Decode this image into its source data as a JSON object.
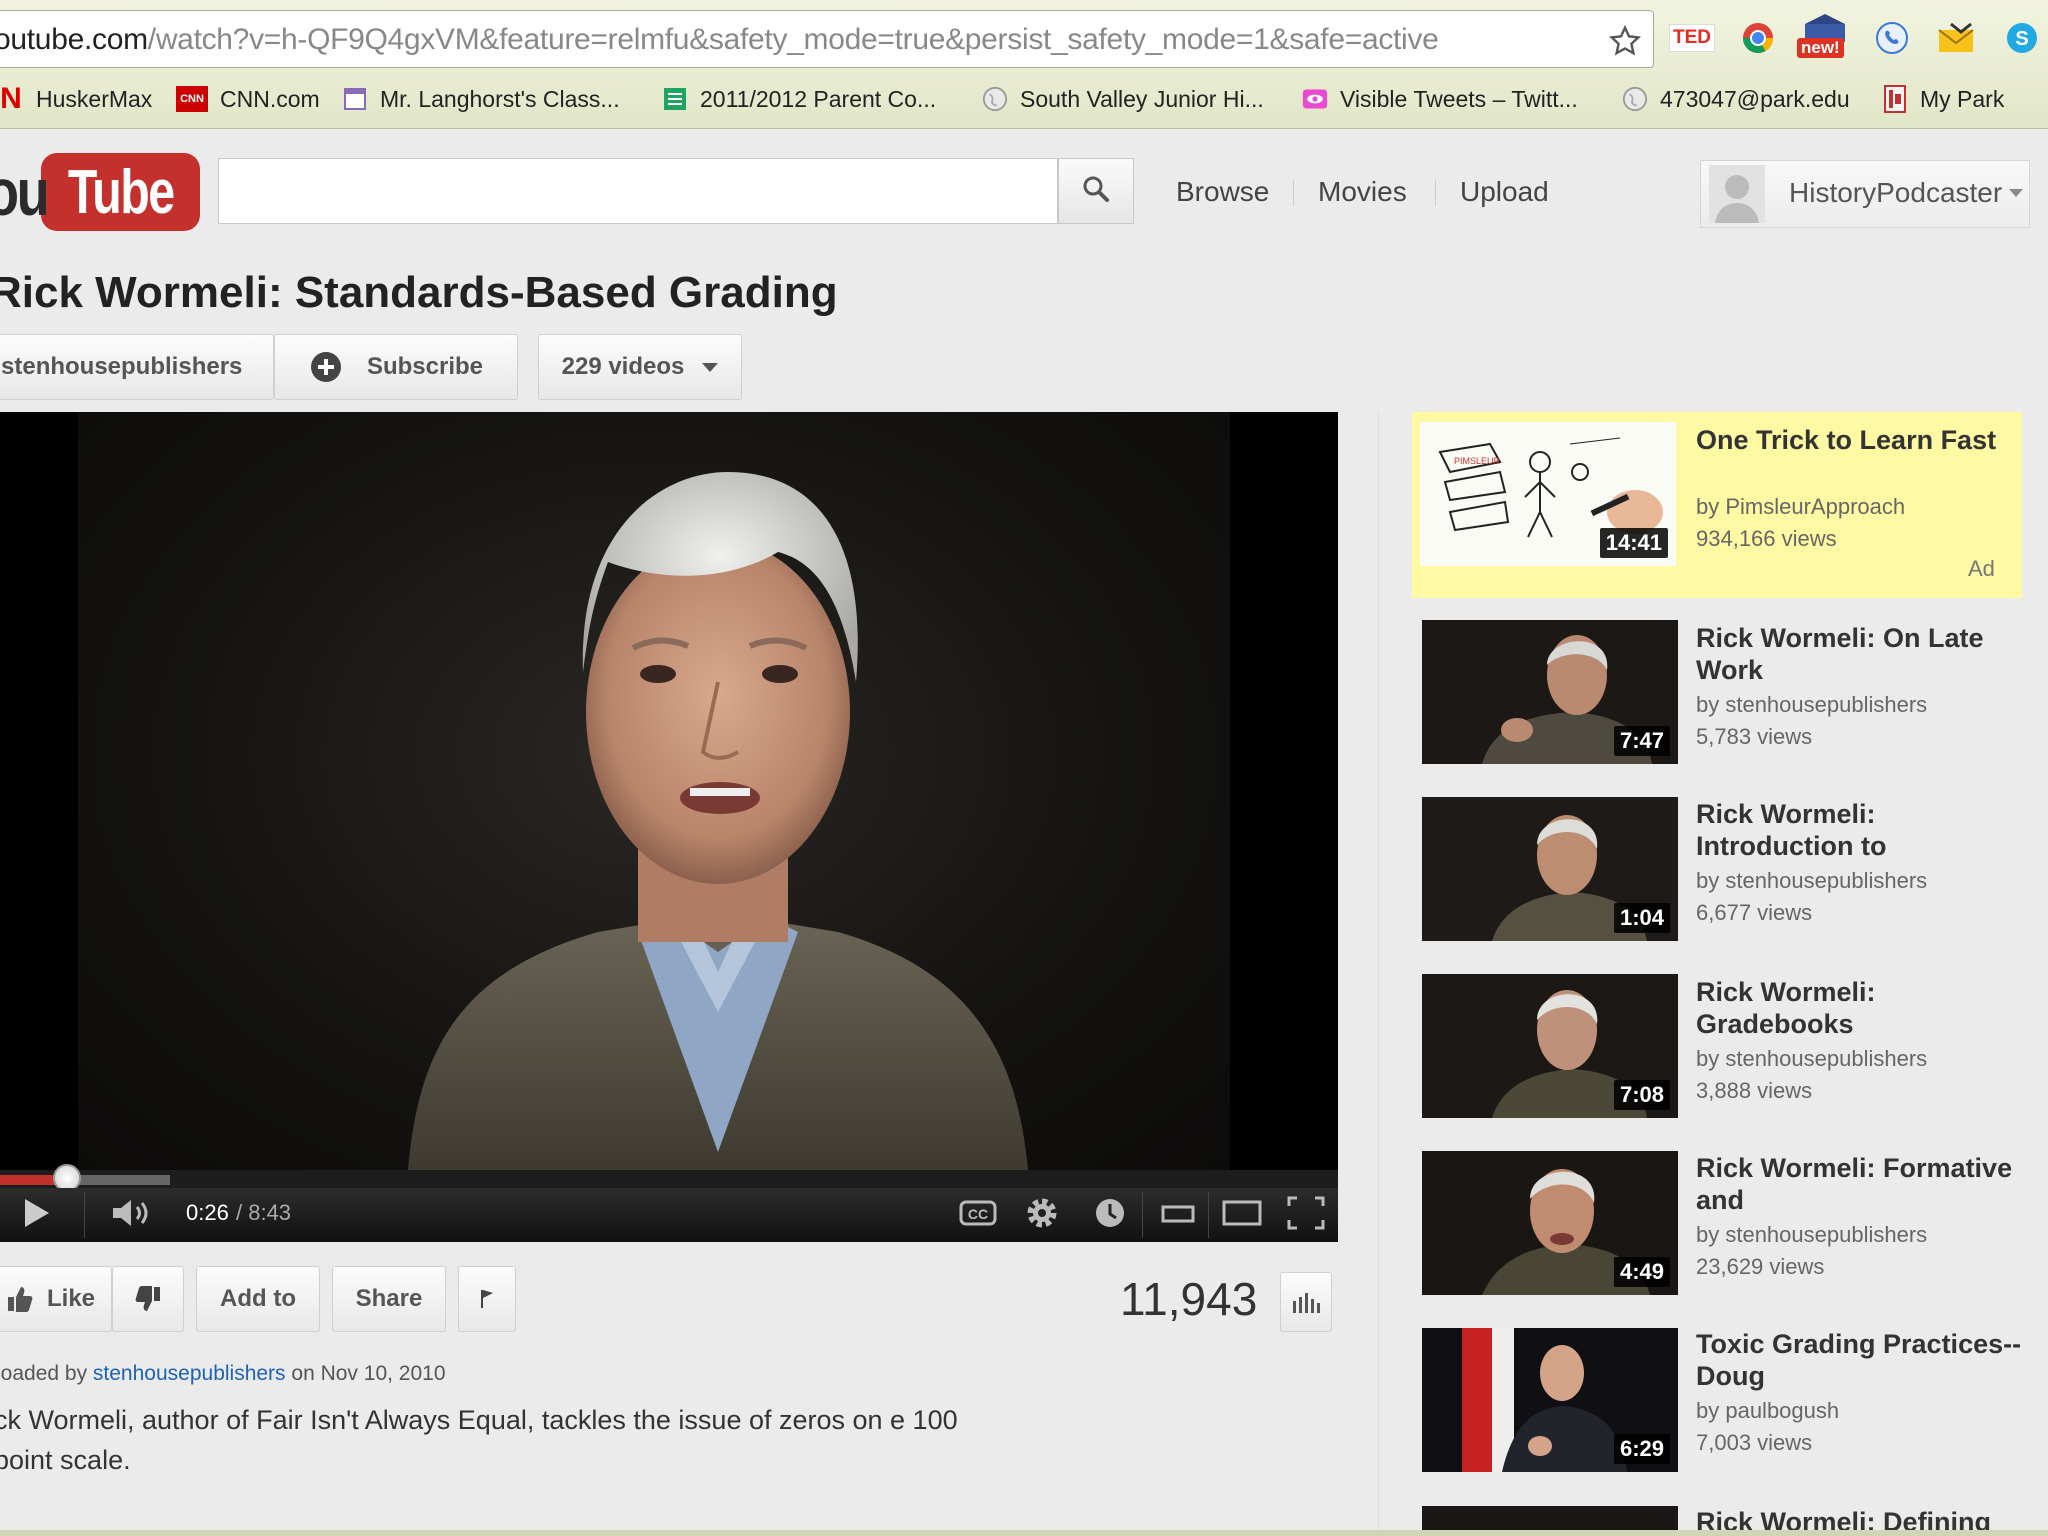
{
  "browser": {
    "url_host": "outube.com",
    "url_path": "/watch?v=h-QF9Q4gxVM&feature=relmfu&safety_mode=true&persist_safety_mode=1&safe=active",
    "bookmarks": [
      {
        "label": "HuskerMax"
      },
      {
        "label": "CNN.com"
      },
      {
        "label": "Mr. Langhorst's Class..."
      },
      {
        "label": "2011/2012 Parent Co..."
      },
      {
        "label": "South Valley Junior Hi..."
      },
      {
        "label": "Visible Tweets – Twitt..."
      },
      {
        "label": "473047@park.edu"
      },
      {
        "label": "My Park"
      }
    ],
    "extensions": {
      "ted": "TED",
      "new": "new!"
    }
  },
  "header": {
    "logo_you": "ou",
    "logo_tube": "Tube",
    "search_value": "",
    "nav": [
      "Browse",
      "Movies",
      "Upload"
    ],
    "username": "HistoryPodcaster"
  },
  "video": {
    "title": "Rick Wormeli: Standards-Based Grading",
    "channel": "stenhousepublishers",
    "subscribe_label": "Subscribe",
    "videos_label": "229 videos",
    "time_current": "0:26",
    "time_total": " / 8:43",
    "progress_fraction": 0.05,
    "views": "11,943",
    "like_label": "Like",
    "add_to_label": "Add to",
    "share_label": "Share",
    "uploaded_prefix": "loaded by ",
    "uploader": "stenhousepublishers",
    "uploaded_suffix": " on Nov 10, 2010",
    "description": "ck Wormeli, author of Fair Isn't Always Equal, tackles the issue of zeros on e 100 point scale."
  },
  "sidebar": {
    "ad": {
      "title": "One Trick to Learn Fast",
      "by": "by PimsleurApproach",
      "views": "934,166 views",
      "duration": "14:41",
      "ad_label": "Ad"
    },
    "related": [
      {
        "title": "Rick Wormeli: On Late Work",
        "by": "by stenhousepublishers",
        "views": "5,783 views",
        "duration": "7:47"
      },
      {
        "title": "Rick Wormeli: Introduction to",
        "by": "by stenhousepublishers",
        "views": "6,677 views",
        "duration": "1:04"
      },
      {
        "title": "Rick Wormeli: Gradebooks",
        "by": "by stenhousepublishers",
        "views": "3,888 views",
        "duration": "7:08"
      },
      {
        "title": "Rick Wormeli: Formative and",
        "by": "by stenhousepublishers",
        "views": "23,629 views",
        "duration": "4:49"
      },
      {
        "title": "Toxic Grading Practices--Doug",
        "by": "by paulbogush",
        "views": "7,003 views",
        "duration": "6:29"
      },
      {
        "title": "Rick Wormeli: Defining",
        "by": "",
        "views": "",
        "duration": ""
      }
    ]
  },
  "colors": {
    "brand_red": "#c4302b",
    "ad_bg": "#fff9a3",
    "link": "#1c62b9"
  }
}
